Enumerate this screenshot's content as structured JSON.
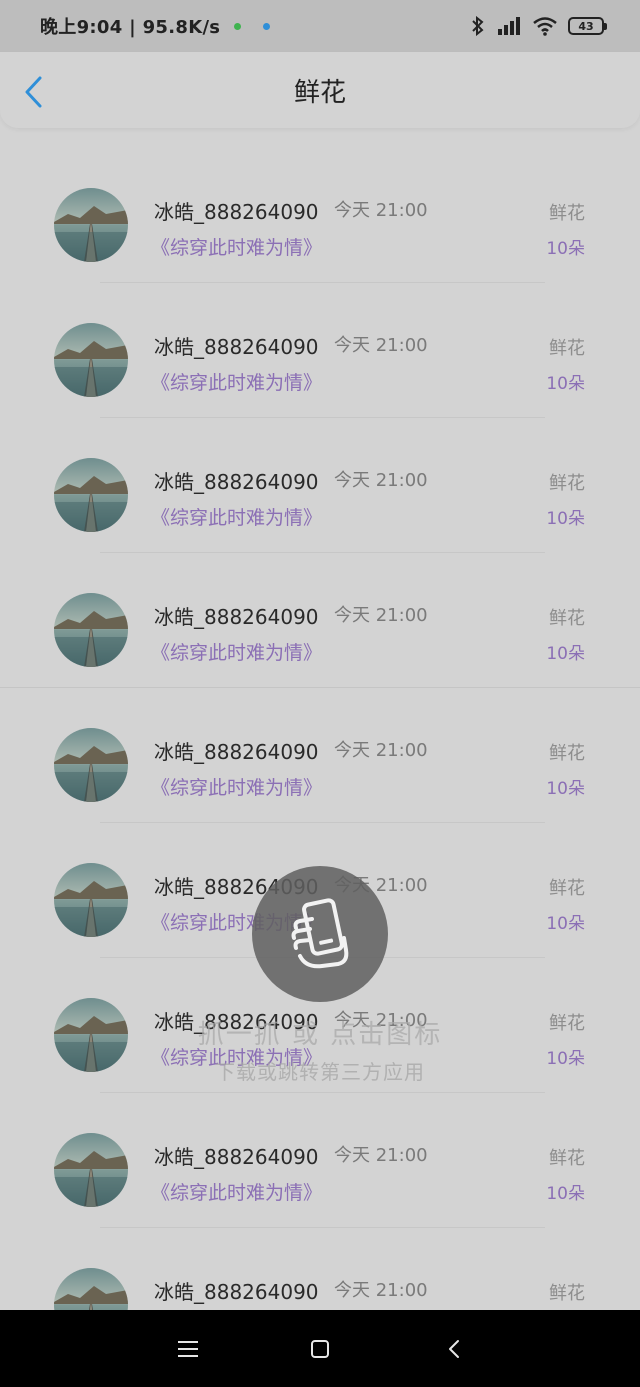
{
  "status_bar": {
    "time": "晚上9:04 | 95.8K/s",
    "battery": "43",
    "icons": [
      "green-dot-icon",
      "blue-dot-icon",
      "bluetooth-icon",
      "signal-icon",
      "wifi-icon",
      "battery-icon"
    ],
    "dot_colors": [
      "#3fb34f",
      "#2f8fd8"
    ]
  },
  "header": {
    "title": "鲜花",
    "back_icon": "chevron-left-icon",
    "accent": "#2f8fd8"
  },
  "list": [
    {
      "name": "冰皓_888264090",
      "time": "今天 21:00",
      "book": "《综穿此时难为情》",
      "gift": "鲜花",
      "count": "10朵"
    },
    {
      "name": "冰皓_888264090",
      "time": "今天 21:00",
      "book": "《综穿此时难为情》",
      "gift": "鲜花",
      "count": "10朵"
    },
    {
      "name": "冰皓_888264090",
      "time": "今天 21:00",
      "book": "《综穿此时难为情》",
      "gift": "鲜花",
      "count": "10朵"
    },
    {
      "name": "冰皓_888264090",
      "time": "今天 21:00",
      "book": "《综穿此时难为情》",
      "gift": "鲜花",
      "count": "10朵"
    },
    {
      "name": "冰皓_888264090",
      "time": "今天 21:00",
      "book": "《综穿此时难为情》",
      "gift": "鲜花",
      "count": "10朵"
    },
    {
      "name": "冰皓_888264090",
      "time": "今天 21:00",
      "book": "《综穿此时难为情》",
      "gift": "鲜花",
      "count": "10朵"
    },
    {
      "name": "冰皓_888264090",
      "time": "今天 21:00",
      "book": "《综穿此时难为情》",
      "gift": "鲜花",
      "count": "10朵"
    },
    {
      "name": "冰皓_888264090",
      "time": "今天 21:00",
      "book": "《综穿此时难为情》",
      "gift": "鲜花",
      "count": "10朵"
    },
    {
      "name": "冰皓_888264090",
      "time": "今天 21:00",
      "book": "",
      "gift": "鲜花",
      "count": ""
    }
  ],
  "overlay_hint": {
    "line1": "抓一抓 或 点击图标",
    "line2": "下载或跳转第三方应用",
    "icon": "hand-phone-icon"
  },
  "nav_bar": {
    "icons": [
      "menu-icon",
      "home-icon",
      "back-icon"
    ]
  }
}
